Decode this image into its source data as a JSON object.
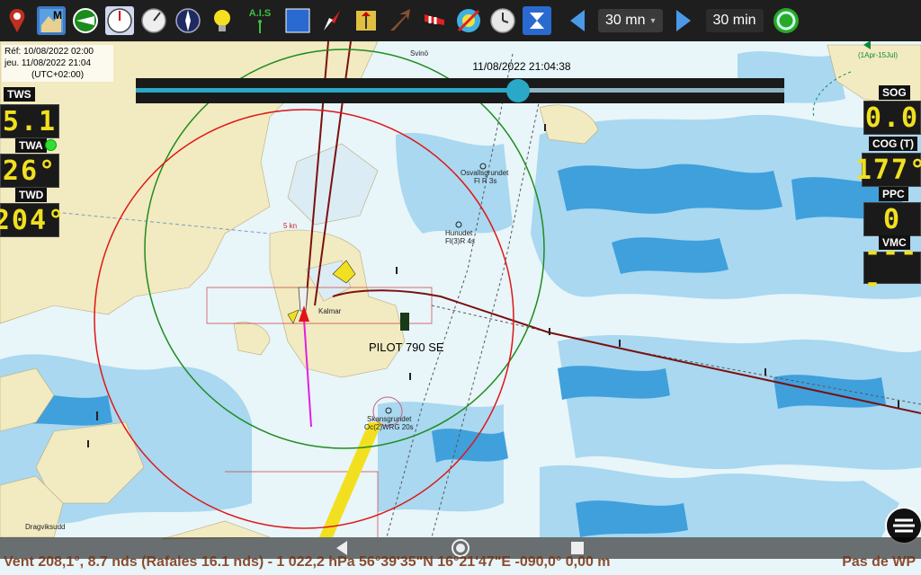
{
  "toolbar": {
    "icons": [
      "map-pin-icon",
      "chart-map-icon",
      "compass-green-icon",
      "gauge-icon",
      "gauge-2-icon",
      "compass-rose-icon",
      "light-bulb-icon",
      "ais-icon",
      "blue-square-icon",
      "compass-needle-icon",
      "up-down-icon",
      "arrow-up-right-icon",
      "windsock-icon",
      "weather-off-icon",
      "clock-icon",
      "hourglass-icon"
    ],
    "ais_label": "A.I.S",
    "duration_select": "30 mn",
    "duration_label": "30 min"
  },
  "ref": {
    "line1": "Réf: 10/08/2022 02:00",
    "line2": "jeu. 11/08/2022 21:04",
    "line3": "(UTC+02:00)"
  },
  "timeline": {
    "label": "11/08/2022 21:04:38",
    "progress": 0.59
  },
  "instruments": {
    "tws": {
      "label": "TWS",
      "value": "5.1"
    },
    "twa": {
      "label": "TWA",
      "value": "26°"
    },
    "twd": {
      "label": "TWD",
      "value": "204°"
    },
    "sog": {
      "label": "SOG",
      "value": "0.0"
    },
    "cog": {
      "label": "COG (T)",
      "value": "177°"
    },
    "ppc": {
      "label": "PPC",
      "value": "0"
    },
    "vmc": {
      "label": "VMC",
      "value": "----"
    }
  },
  "map": {
    "places": {
      "svino": "Svinö",
      "osvall": "Osvallsgrundet",
      "osvall_light": "Fl R 3s",
      "hunudet": "Hunudet",
      "hunudet_light": "Fl(3)R 4s",
      "kalmar": "Kalmar",
      "skans": "Skansgrundet",
      "skans_light": "Oc(2)WRG 20s",
      "dragvik": "Dragviksudd",
      "season": "(1Apr-15Jul)",
      "speed": "5 kn"
    },
    "boat_name": "PILOT 790 SE"
  },
  "status": {
    "text": "Vent 208,1°, 8.7 nds (Rafales 16.1 nds) - 1 022,2 hPa 56°39'35\"N 16°21'47\"E -090,0° 0,00 m",
    "right": "Pas de WP"
  }
}
